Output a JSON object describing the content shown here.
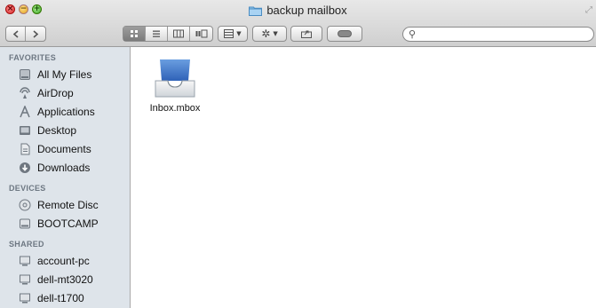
{
  "window": {
    "title": "backup mailbox"
  },
  "toolbar": {
    "back_icon": "chevron-left-icon",
    "forward_icon": "chevron-right-icon",
    "view_modes": [
      "icon-view",
      "list-view",
      "column-view",
      "coverflow-view"
    ],
    "active_view": "icon-view",
    "arrange_icon": "arrange-grid-icon",
    "action_icon": "gear-icon",
    "share_icon": "share-icon",
    "tag_icon": "tag-icon",
    "search_placeholder": ""
  },
  "sidebar": {
    "favorites": {
      "header": "FAVORITES",
      "items": [
        {
          "label": "All My Files",
          "icon": "all-files-icon"
        },
        {
          "label": "AirDrop",
          "icon": "airdrop-icon"
        },
        {
          "label": "Applications",
          "icon": "applications-icon"
        },
        {
          "label": "Desktop",
          "icon": "desktop-icon"
        },
        {
          "label": "Documents",
          "icon": "documents-icon"
        },
        {
          "label": "Downloads",
          "icon": "downloads-icon"
        }
      ]
    },
    "devices": {
      "header": "DEVICES",
      "items": [
        {
          "label": "Remote Disc",
          "icon": "remote-disc-icon"
        },
        {
          "label": "BOOTCAMP",
          "icon": "hard-drive-icon"
        }
      ]
    },
    "shared": {
      "header": "SHARED",
      "items": [
        {
          "label": "account-pc",
          "icon": "network-computer-icon"
        },
        {
          "label": "dell-mt3020",
          "icon": "network-computer-icon"
        },
        {
          "label": "dell-t1700",
          "icon": "network-computer-icon"
        }
      ]
    }
  },
  "content": {
    "files": [
      {
        "name": "Inbox.mbox",
        "icon": "mailbox-icon"
      }
    ]
  }
}
